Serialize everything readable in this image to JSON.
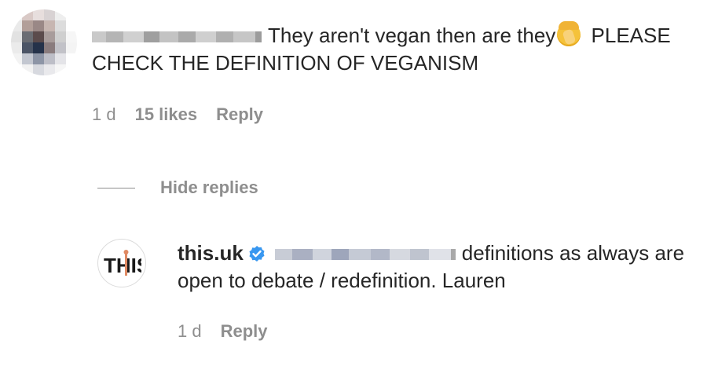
{
  "comment": {
    "text": "They aren't vegan then are they",
    "text_after_emoji": " PLEASE CHECK THE DEFINITION OF VEGANISM",
    "emoji": "face-palm-emoji",
    "time": "1 d",
    "likes": "15 likes",
    "reply_label": "Reply"
  },
  "hide_replies_label": "Hide replies",
  "reply": {
    "username": "this.uk",
    "text": "definitions as always are open to debate / redefinition. Lauren",
    "time": "1 d",
    "reply_label": "Reply",
    "avatar_logo_text": "THIS"
  },
  "colors": {
    "primary_text": "#262626",
    "secondary_text": "#8e8e8e",
    "verified_blue": "#3897f0"
  }
}
